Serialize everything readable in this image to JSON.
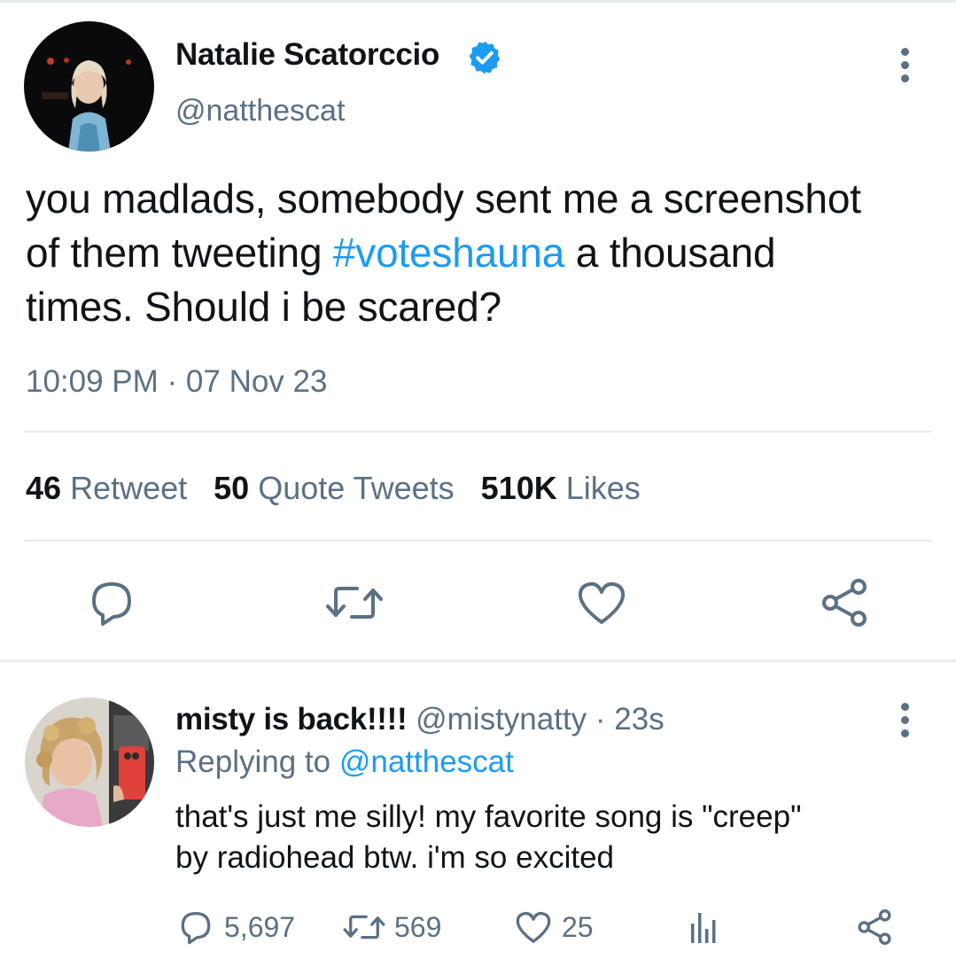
{
  "main_tweet": {
    "author": {
      "display_name": "Natalie Scatorccio",
      "handle": "@natthescat",
      "verified": true
    },
    "text_lines": [
      [
        "you madlads, somebody sent me a screenshot"
      ],
      [
        "of them tweeting ",
        "#voteshauna",
        " a thousand"
      ],
      [
        "times. Should i be scared?"
      ]
    ],
    "text_line1": "you madlads, somebody sent me a screenshot",
    "text_line2_pre": "of them tweeting ",
    "text_line2_hashtag": "#voteshauna",
    "text_line2_post": " a thousand",
    "text_line3": "times. Should i be scared?",
    "timestamp": "10:09 PM · 07 Nov 23",
    "stats": {
      "retweets_count": "46",
      "retweets_label": "Retweet",
      "quotes_count": "50",
      "quotes_label": "Quote Tweets",
      "likes_count": "510K",
      "likes_label": "Likes"
    },
    "actions": [
      "reply-icon",
      "retweet-icon",
      "like-icon",
      "share-icon"
    ]
  },
  "reply": {
    "author": {
      "display_name": "misty is back!!!!",
      "handle": "@mistynatty",
      "time": "· 23s"
    },
    "replying_prefix": "Replying to ",
    "replying_to": "@natthescat",
    "text_line1": "that's just me silly! my favorite song is \"creep\"",
    "text_line2": "by radiohead btw. i'm so excited",
    "actions": {
      "replies": "5,697",
      "retweets": "569",
      "likes": "25"
    }
  },
  "colors": {
    "accent": "#1d9bf0",
    "secondary_text": "#5b7083",
    "primary_text": "#0f1419",
    "divider": "#e6ecf0"
  }
}
